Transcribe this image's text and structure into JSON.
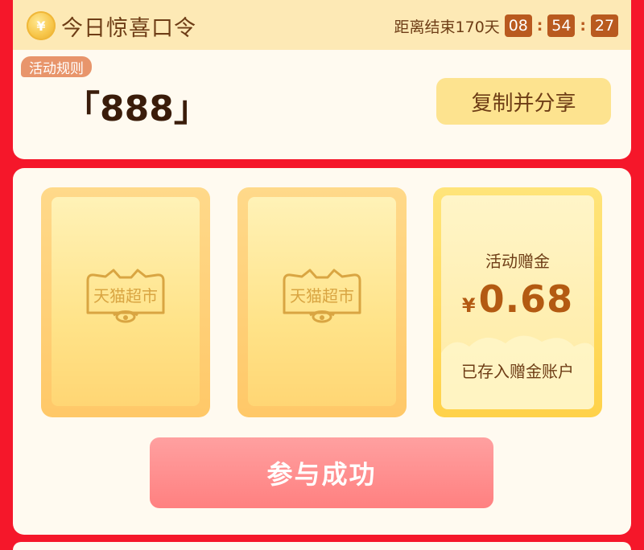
{
  "header": {
    "coin_symbol": "¥",
    "title": "今日惊喜口令",
    "countdown": {
      "label": "距离结束170天",
      "hours": "08",
      "minutes": "54",
      "seconds": "27",
      "separator": ":"
    }
  },
  "rules_tag": "活动规则",
  "passcode": "「888」",
  "share_button": "复制并分享",
  "reward_cards": [
    {
      "logo_text": "天猫超市",
      "icon": "tmall-cat-logo-icon"
    },
    {
      "logo_text": "天猫超市",
      "icon": "tmall-cat-logo-icon"
    }
  ],
  "prize": {
    "title": "活动赠金",
    "currency": "¥",
    "amount": "0.68",
    "note": "已存入赠金账户"
  },
  "cta_button": "参与成功",
  "colors": {
    "page_bg": "#f5172a",
    "card_bg": "#fffaf0",
    "brown_text": "#6e3d16",
    "countdown_box": "#b95a1f",
    "cta": "#ff8a8a",
    "rules_tag": "#e8956b"
  }
}
